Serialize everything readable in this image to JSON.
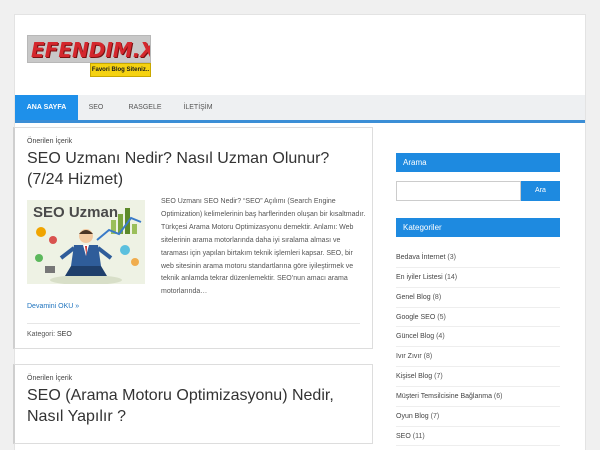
{
  "logo": {
    "text": "EFENDIM.XYZ",
    "tagline": "Favori Blog Siteniz..",
    "colors": {
      "text": "#d4272d",
      "tagline_bg": "#f5d211"
    }
  },
  "nav": {
    "items": [
      {
        "label": "ANA SAYFA",
        "active": true
      },
      {
        "label": "SEO",
        "active": false
      },
      {
        "label": "RASGELE",
        "active": false
      },
      {
        "label": "İLETİŞİM",
        "active": false
      }
    ],
    "accent": "#1e90ea"
  },
  "posts": [
    {
      "category": "Önerilen İçerik",
      "title": "SEO Uzmanı Nedir? Nasıl Uzman Olunur? (7/24 Hizmet)",
      "image_label": "SEO Uzman",
      "excerpt": "SEO Uzmanı SEO Nedir? “SEO” Açılımı (Search Engine Optimization) kelimelerinin baş harflerinden oluşan bir kısaltmadır. Türkçesi Arama Motoru Optimizasyonu demektir. Anlamı: Web sitelerinin arama motorlarında daha iyi sıralama alması ve taraması için yapılan birtakım teknik işlemleri kapsar. SEO, bir web sitesinin arama motoru standartlarına göre iyileştirmek ve teknik anlamda tekrar düzenlemektir.  SEO’nun amacı arama motorlarında…",
      "read_more": "Devamini OKU »",
      "meta_label": "Kategori:",
      "meta_value": "SEO"
    },
    {
      "category": "Önerilen İçerik",
      "title": "SEO (Arama Motoru Optimizasyonu) Nedir, Nasıl Yapılır ?"
    }
  ],
  "sidebar": {
    "search_title": "Arama",
    "search_placeholder": "",
    "search_button": "Ara",
    "categories_title": "Kategoriler",
    "categories": [
      {
        "name": "Bedava İnternet",
        "count": "(3)"
      },
      {
        "name": "En iyiler Listesi",
        "count": "(14)"
      },
      {
        "name": "Genel Blog",
        "count": "(8)"
      },
      {
        "name": "Google SEO",
        "count": "(5)"
      },
      {
        "name": "Güncel Blog",
        "count": "(4)"
      },
      {
        "name": "Ivır Zıvır",
        "count": "(8)"
      },
      {
        "name": "Kişisel Blog",
        "count": "(7)"
      },
      {
        "name": "Müşteri Temsilcisine Bağlanma",
        "count": "(6)"
      },
      {
        "name": "Oyun Blog",
        "count": "(7)"
      },
      {
        "name": "SEO",
        "count": "(11)"
      }
    ]
  }
}
